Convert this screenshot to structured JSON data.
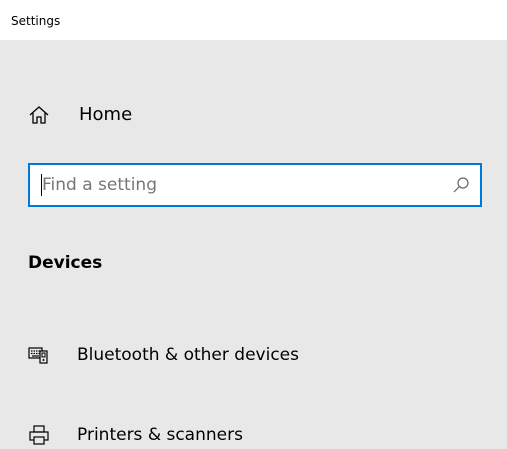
{
  "window": {
    "title": "Settings"
  },
  "nav": {
    "home": {
      "label": "Home",
      "icon": "home-icon"
    }
  },
  "search": {
    "placeholder": "Find a setting",
    "value": "",
    "icon": "search-icon"
  },
  "section": {
    "heading": "Devices",
    "items": [
      {
        "label": "Bluetooth & other devices",
        "icon": "bluetooth-devices-icon"
      },
      {
        "label": "Printers & scanners",
        "icon": "printer-icon"
      }
    ]
  },
  "colors": {
    "accent": "#0078d7",
    "sidebar_background": "#e8e8e8",
    "title_bar_background": "#ffffff",
    "placeholder_text": "#767676"
  }
}
